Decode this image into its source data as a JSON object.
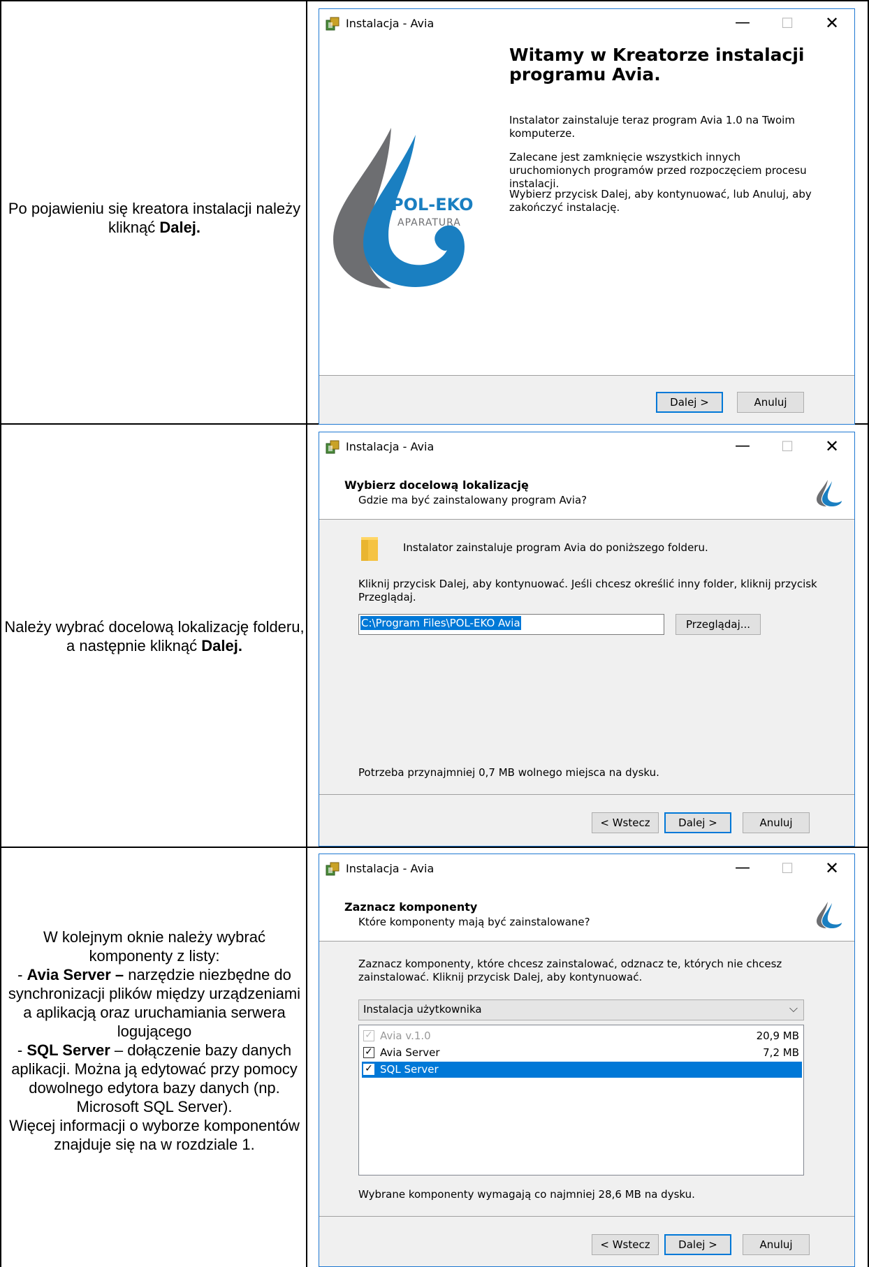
{
  "rows": [
    {
      "desc_html_parts": [
        "Po pojawieniu się kreatora instalacji należy kliknąć ",
        "Dalej."
      ],
      "window": {
        "title": "Instalacja - Avia",
        "welcome_title": "Witamy w Kreatorze instalacji programu Avia.",
        "para1": "Instalator zainstaluje teraz program Avia 1.0 na Twoim komputerze.",
        "para2": "Zalecane jest zamknięcie wszystkich innych uruchomionych programów przed rozpoczęciem procesu instalacji.",
        "para3": "Wybierz przycisk Dalej, aby kontynuować, lub Anuluj, aby zakończyć instalację.",
        "logo_main": "POL-EKO",
        "logo_sub": "APARATURA",
        "next": "Dalej >",
        "cancel": "Anuluj"
      }
    },
    {
      "desc_plain": "Należy wybrać docelową lokalizację folderu, a następnie kliknąć ",
      "desc_bold": "Dalej.",
      "window": {
        "title": "Instalacja - Avia",
        "header_title": "Wybierz docelową lokalizację",
        "header_sub": "Gdzie ma być zainstalowany program Avia?",
        "folder_text": "Instalator zainstaluje program Avia do poniższego folderu.",
        "instruction": "Kliknij przycisk Dalej, aby kontynuować. Jeśli chcesz określić inny folder, kliknij przycisk Przeglądaj.",
        "path": "C:\\Program Files\\POL-EKO Avia",
        "browse": "Przeglądaj...",
        "space": "Potrzeba przynajmniej 0,7 MB wolnego miejsca na dysku.",
        "back": "< Wstecz",
        "next": "Dalej >",
        "cancel": "Anuluj"
      }
    },
    {
      "desc_lines": {
        "intro": "W kolejnym oknie należy wybrać komponenty z listy:",
        "item1_prefix": "- ",
        "item1_bold": "Avia Server –",
        "item1_rest": " narzędzie niezbędne do synchronizacji plików między urządzeniami a aplikacją oraz uruchamiania serwera logującego",
        "item2_prefix": "- ",
        "item2_bold": "SQL Server",
        "item2_rest": " – dołączenie bazy danych aplikacji. Można ją edytować przy pomocy dowolnego edytora bazy danych (np. Microsoft SQL Server).",
        "more": "Więcej informacji o wyborze komponentów znajduje się na w rozdziale 1."
      },
      "window": {
        "title": "Instalacja - Avia",
        "header_title": "Zaznacz komponenty",
        "header_sub": "Które komponenty mają być zainstalowane?",
        "instruction": "Zaznacz komponenty, które chcesz zainstalować, odznacz te, których nie chcesz zainstalować. Kliknij przycisk Dalej, aby kontynuować.",
        "install_type": "Instalacja użytkownika",
        "components": [
          {
            "label": "Avia v.1.0",
            "size": "20,9 MB",
            "checked": true,
            "state": "disabled"
          },
          {
            "label": "Avia Server",
            "size": "7,2 MB",
            "checked": true,
            "state": "normal"
          },
          {
            "label": "SQL Server",
            "size": "",
            "checked": true,
            "state": "selected"
          }
        ],
        "space": "Wybrane komponenty wymagają co najmniej 28,6 MB na dysku.",
        "back": "< Wstecz",
        "next": "Dalej >",
        "cancel": "Anuluj"
      }
    }
  ],
  "colors": {
    "accent_blue": "#0078d7",
    "logo_blue": "#1a7fc1",
    "logo_gray": "#6d6e71"
  }
}
